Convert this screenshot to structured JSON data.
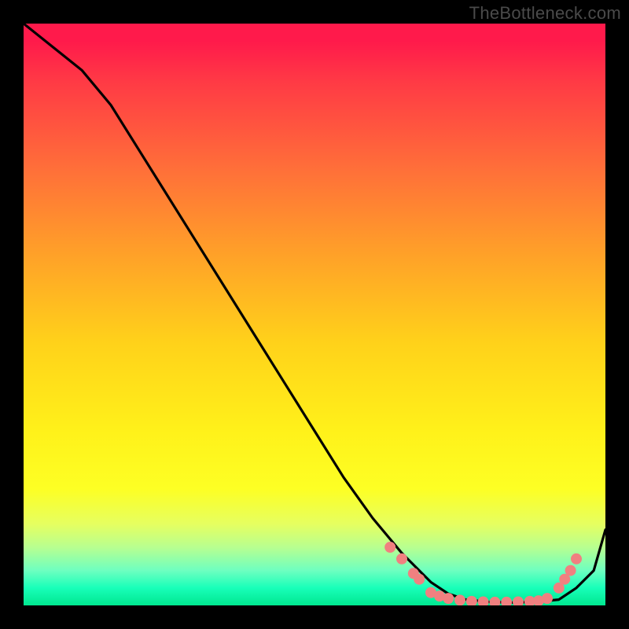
{
  "watermark": "TheBottleneck.com",
  "colors": {
    "frame": "#000000",
    "curve": "#000000",
    "dot_fill": "#f08080",
    "dot_stroke": "#f08080"
  },
  "chart_data": {
    "type": "line",
    "title": "",
    "xlabel": "",
    "ylabel": "",
    "xlim": [
      0,
      100
    ],
    "ylim": [
      0,
      100
    ],
    "grid": false,
    "note": "Axes have no visible tick labels; values normalized to 0–100. y is the black curve height; 100=top, 0=bottom. Gradient band boundaries roughly correspond to y values listed in bands.",
    "series": [
      {
        "name": "bottleneck-curve",
        "x": [
          0,
          5,
          10,
          15,
          20,
          25,
          30,
          35,
          40,
          45,
          50,
          55,
          60,
          65,
          68,
          70,
          73,
          76,
          80,
          84,
          88,
          92,
          95,
          98,
          100
        ],
        "y": [
          100,
          96,
          92,
          86,
          78,
          70,
          62,
          54,
          46,
          38,
          30,
          22,
          15,
          9,
          6,
          4,
          2,
          1,
          0.6,
          0.5,
          0.6,
          1,
          3,
          6,
          13
        ]
      }
    ],
    "highlight_dots": {
      "name": "salmon-dots",
      "points": [
        {
          "x": 63,
          "y": 10
        },
        {
          "x": 65,
          "y": 8
        },
        {
          "x": 67,
          "y": 5.5
        },
        {
          "x": 68,
          "y": 4.5
        },
        {
          "x": 70,
          "y": 2.2
        },
        {
          "x": 71.5,
          "y": 1.6
        },
        {
          "x": 73,
          "y": 1.2
        },
        {
          "x": 75,
          "y": 0.9
        },
        {
          "x": 77,
          "y": 0.7
        },
        {
          "x": 79,
          "y": 0.6
        },
        {
          "x": 81,
          "y": 0.55
        },
        {
          "x": 83,
          "y": 0.55
        },
        {
          "x": 85,
          "y": 0.6
        },
        {
          "x": 87,
          "y": 0.7
        },
        {
          "x": 88.5,
          "y": 0.8
        },
        {
          "x": 90,
          "y": 1.2
        },
        {
          "x": 92,
          "y": 3
        },
        {
          "x": 93,
          "y": 4.5
        },
        {
          "x": 94,
          "y": 6
        },
        {
          "x": 95,
          "y": 8
        }
      ]
    },
    "bands": [
      {
        "label": "red",
        "y_from": 100,
        "y_to": 60
      },
      {
        "label": "orange",
        "y_from": 60,
        "y_to": 35
      },
      {
        "label": "yellow",
        "y_from": 35,
        "y_to": 10
      },
      {
        "label": "green",
        "y_from": 10,
        "y_to": 0
      }
    ]
  }
}
